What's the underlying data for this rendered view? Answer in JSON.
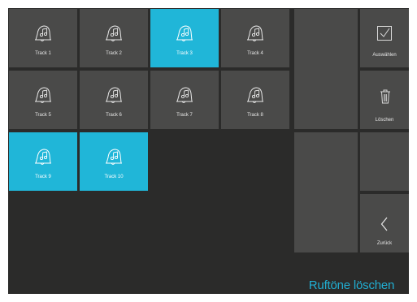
{
  "tracks": [
    {
      "label": "Track 1",
      "selected": false
    },
    {
      "label": "Track 2",
      "selected": false
    },
    {
      "label": "Track 3",
      "selected": true
    },
    {
      "label": "Track 4",
      "selected": false
    },
    {
      "label": "Track 5",
      "selected": false
    },
    {
      "label": "Track 6",
      "selected": false
    },
    {
      "label": "Track 7",
      "selected": false
    },
    {
      "label": "Track 8",
      "selected": false
    },
    {
      "label": "Track 9",
      "selected": true
    },
    {
      "label": "Track 10",
      "selected": true
    }
  ],
  "actions": {
    "select_label": "Auswählen",
    "delete_label": "Löschen",
    "back_label": "Zurück"
  },
  "screen_title": "Ruftöne löschen",
  "colors": {
    "background": "#2b2b2a",
    "tile": "#4a4a49",
    "accent": "#20b6d8",
    "title": "#21aed2"
  },
  "icons": {
    "track": "bell-note-icon",
    "select": "checkbox-icon",
    "delete": "trash-icon",
    "back": "chevron-left-icon"
  }
}
